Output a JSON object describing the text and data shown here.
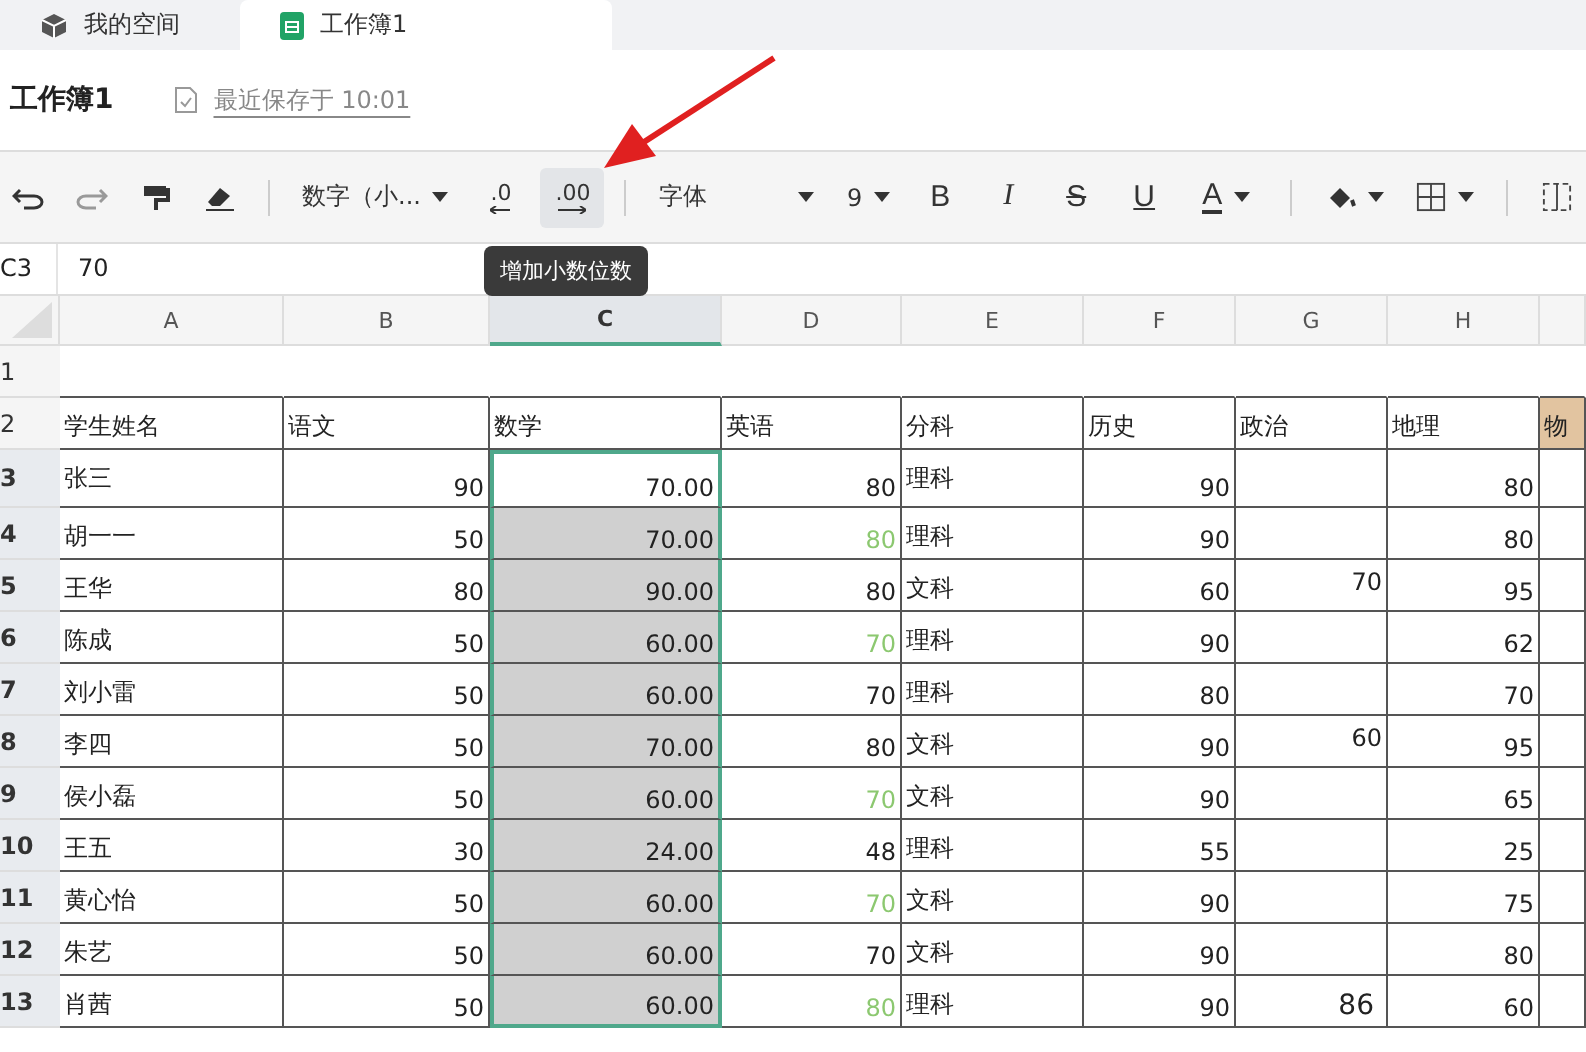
{
  "tabs": [
    {
      "label": "我的空间",
      "kind": "space",
      "selected": false
    },
    {
      "label": "工作簿1",
      "kind": "sheet",
      "selected": true
    }
  ],
  "header": {
    "title": "工作簿1",
    "save_status": "最近保存于 10:01"
  },
  "toolbar": [
    {
      "kind": "undo",
      "hovered": false
    },
    {
      "kind": "redo",
      "hovered": false
    },
    {
      "kind": "painter",
      "hovered": false
    },
    {
      "kind": "eraser",
      "hovered": false
    },
    {
      "kind": "sep"
    },
    {
      "kind": "dropdown",
      "label": "数字（小...",
      "hovered": false
    },
    {
      "kind": "decimal-less",
      "label": ".0",
      "hovered": false
    },
    {
      "kind": "decimal-more",
      "label": ".00",
      "hovered": true
    },
    {
      "kind": "sep"
    },
    {
      "kind": "font-dropdown",
      "label": "字体",
      "hovered": false
    },
    {
      "kind": "dropdown",
      "label": "9",
      "hovered": false
    },
    {
      "kind": "bold",
      "label": "B",
      "hovered": false
    },
    {
      "kind": "italic",
      "label": "I",
      "hovered": false
    },
    {
      "kind": "strike",
      "label": "S",
      "hovered": false
    },
    {
      "kind": "underline",
      "label": "U",
      "hovered": false
    },
    {
      "kind": "textcolor",
      "label": "A",
      "hovered": false
    },
    {
      "kind": "sep"
    },
    {
      "kind": "fill",
      "hovered": false
    },
    {
      "kind": "border",
      "hovered": false
    },
    {
      "kind": "sep"
    },
    {
      "kind": "merge",
      "hovered": false
    }
  ],
  "tooltip": "增加小数位数",
  "formula_bar": {
    "cell_ref": "C3",
    "value": "70"
  },
  "columns": [
    {
      "label": "A",
      "selected": false
    },
    {
      "label": "B",
      "selected": false
    },
    {
      "label": "C",
      "selected": true
    },
    {
      "label": "D",
      "selected": false
    },
    {
      "label": "E",
      "selected": false
    },
    {
      "label": "F",
      "selected": false
    },
    {
      "label": "G",
      "selected": false
    },
    {
      "label": "H",
      "selected": false
    }
  ],
  "rows": [
    {
      "number": "1",
      "selected": false,
      "cells": [
        null,
        null,
        null,
        null,
        null,
        null,
        null,
        null,
        null
      ]
    },
    {
      "number": "2",
      "selected": false,
      "cells": [
        {
          "kind": "text",
          "text": "学生姓名"
        },
        {
          "kind": "text",
          "text": "语文"
        },
        {
          "kind": "text",
          "text": "数学"
        },
        {
          "kind": "text",
          "text": "英语"
        },
        {
          "kind": "text",
          "text": "分科"
        },
        {
          "kind": "text",
          "text": "历史"
        },
        {
          "kind": "text",
          "text": "政治"
        },
        {
          "kind": "text",
          "text": "地理"
        },
        {
          "kind": "highlight",
          "text": "物",
          "color": "#e2c4a0"
        }
      ]
    },
    {
      "number": "3",
      "selected": true,
      "cells": [
        {
          "kind": "text",
          "text": "张三"
        },
        {
          "kind": "number",
          "text": "90"
        },
        {
          "kind": "number",
          "text": "70.00",
          "selected": true,
          "active": true
        },
        {
          "kind": "number",
          "text": "80"
        },
        {
          "kind": "text",
          "text": "理科"
        },
        {
          "kind": "number",
          "text": "90"
        },
        null,
        {
          "kind": "number",
          "text": "80"
        },
        null
      ]
    },
    {
      "number": "4",
      "selected": true,
      "cells": [
        {
          "kind": "text",
          "text": "胡一一"
        },
        {
          "kind": "number",
          "text": "50"
        },
        {
          "kind": "number",
          "text": "70.00",
          "selected": true,
          "active": false
        },
        {
          "kind": "number",
          "text": "80",
          "color": "#8cc870"
        },
        {
          "kind": "text",
          "text": "理科"
        },
        {
          "kind": "number",
          "text": "90"
        },
        null,
        {
          "kind": "number",
          "text": "80"
        },
        null
      ]
    },
    {
      "number": "5",
      "selected": true,
      "cells": [
        {
          "kind": "text",
          "text": "王华"
        },
        {
          "kind": "number",
          "text": "80"
        },
        {
          "kind": "number",
          "text": "90.00",
          "selected": true,
          "active": false
        },
        {
          "kind": "number",
          "text": "80"
        },
        {
          "kind": "text",
          "text": "文科"
        },
        {
          "kind": "number",
          "text": "60"
        },
        {
          "kind": "raised",
          "text": "70"
        },
        {
          "kind": "number",
          "text": "95"
        },
        null
      ]
    },
    {
      "number": "6",
      "selected": true,
      "cells": [
        {
          "kind": "text",
          "text": "陈成"
        },
        {
          "kind": "number",
          "text": "50"
        },
        {
          "kind": "number",
          "text": "60.00",
          "selected": true,
          "active": false
        },
        {
          "kind": "number",
          "text": "70",
          "color": "#8cc870"
        },
        {
          "kind": "text",
          "text": "理科"
        },
        {
          "kind": "number",
          "text": "90"
        },
        null,
        {
          "kind": "number",
          "text": "62"
        },
        null
      ]
    },
    {
      "number": "7",
      "selected": true,
      "cells": [
        {
          "kind": "text",
          "text": "刘小雷"
        },
        {
          "kind": "number",
          "text": "50"
        },
        {
          "kind": "number",
          "text": "60.00",
          "selected": true,
          "active": false
        },
        {
          "kind": "number",
          "text": "70"
        },
        {
          "kind": "text",
          "text": "理科"
        },
        {
          "kind": "number",
          "text": "80"
        },
        null,
        {
          "kind": "number",
          "text": "70"
        },
        null
      ]
    },
    {
      "number": "8",
      "selected": true,
      "cells": [
        {
          "kind": "text",
          "text": "李四"
        },
        {
          "kind": "number",
          "text": "50"
        },
        {
          "kind": "number",
          "text": "70.00",
          "selected": true,
          "active": false
        },
        {
          "kind": "number",
          "text": "80"
        },
        {
          "kind": "text",
          "text": "文科"
        },
        {
          "kind": "number",
          "text": "90"
        },
        {
          "kind": "raised",
          "text": "60"
        },
        {
          "kind": "number",
          "text": "95"
        },
        null
      ]
    },
    {
      "number": "9",
      "selected": true,
      "cells": [
        {
          "kind": "text",
          "text": "侯小磊"
        },
        {
          "kind": "number",
          "text": "50"
        },
        {
          "kind": "number",
          "text": "60.00",
          "selected": true,
          "active": false
        },
        {
          "kind": "number",
          "text": "70",
          "color": "#8cc870"
        },
        {
          "kind": "text",
          "text": "文科"
        },
        {
          "kind": "number",
          "text": "90"
        },
        null,
        {
          "kind": "number",
          "text": "65"
        },
        null
      ]
    },
    {
      "number": "10",
      "selected": true,
      "cells": [
        {
          "kind": "text",
          "text": "王五"
        },
        {
          "kind": "number",
          "text": "30"
        },
        {
          "kind": "number",
          "text": "24.00",
          "selected": true,
          "active": false
        },
        {
          "kind": "number",
          "text": "48"
        },
        {
          "kind": "text",
          "text": "理科"
        },
        {
          "kind": "number",
          "text": "55"
        },
        null,
        {
          "kind": "number",
          "text": "25"
        },
        null
      ]
    },
    {
      "number": "11",
      "selected": true,
      "cells": [
        {
          "kind": "text",
          "text": "黄心怡"
        },
        {
          "kind": "number",
          "text": "50"
        },
        {
          "kind": "number",
          "text": "60.00",
          "selected": true,
          "active": false
        },
        {
          "kind": "number",
          "text": "70",
          "color": "#8cc870"
        },
        {
          "kind": "text",
          "text": "文科"
        },
        {
          "kind": "number",
          "text": "90"
        },
        null,
        {
          "kind": "number",
          "text": "75"
        },
        null
      ]
    },
    {
      "number": "12",
      "selected": true,
      "cells": [
        {
          "kind": "text",
          "text": "朱艺"
        },
        {
          "kind": "number",
          "text": "50"
        },
        {
          "kind": "number",
          "text": "60.00",
          "selected": true,
          "active": false
        },
        {
          "kind": "number",
          "text": "70"
        },
        {
          "kind": "text",
          "text": "文科"
        },
        {
          "kind": "number",
          "text": "90"
        },
        null,
        {
          "kind": "number",
          "text": "80"
        },
        null
      ]
    },
    {
      "number": "13",
      "selected": true,
      "cells": [
        {
          "kind": "text",
          "text": "肖茜"
        },
        {
          "kind": "number",
          "text": "50"
        },
        {
          "kind": "number",
          "text": "60.00",
          "selected": true,
          "active": false
        },
        {
          "kind": "number",
          "text": "80",
          "color": "#8cc870"
        },
        {
          "kind": "text",
          "text": "理科"
        },
        {
          "kind": "number",
          "text": "90"
        },
        {
          "kind": "middle",
          "text": "86"
        },
        {
          "kind": "number",
          "text": "60"
        },
        null
      ]
    }
  ]
}
